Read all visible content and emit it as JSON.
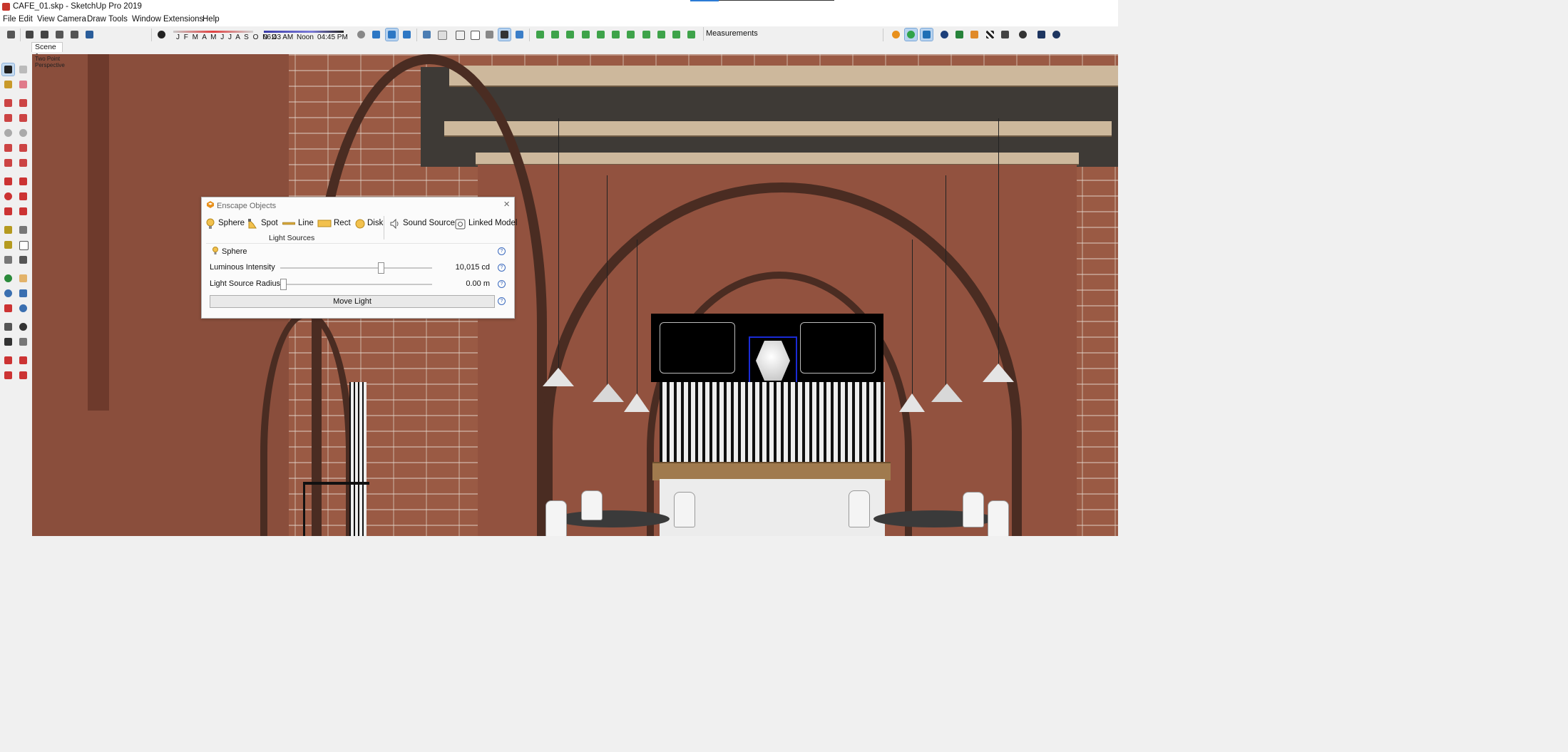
{
  "window": {
    "title": "CAFE_01.skp - SketchUp Pro 2019"
  },
  "menu": [
    "File",
    "Edit",
    "View",
    "Camera",
    "Draw",
    "Tools",
    "Window",
    "Extensions",
    "Help"
  ],
  "shadow": {
    "months": "J F M A M J J A S O N D",
    "time_start": "06:43 AM",
    "time_mid": "Noon",
    "time_end": "04:45 PM"
  },
  "measurements": {
    "label": "Measurements"
  },
  "scene": {
    "tab": "Scene 1"
  },
  "viewport": {
    "label": "Two Point\nPerspective"
  },
  "enscape": {
    "title": "Enscape Objects",
    "objects": [
      {
        "label": "Sphere",
        "icon": "bulb-icon"
      },
      {
        "label": "Spot",
        "icon": "spotlight-icon"
      },
      {
        "label": "Line",
        "icon": "line-light-icon"
      },
      {
        "label": "Rect",
        "icon": "rect-light-icon"
      },
      {
        "label": "Disk",
        "icon": "disk-light-icon"
      },
      {
        "label": "Sound Source",
        "icon": "speaker-icon"
      },
      {
        "label": "Linked Model",
        "icon": "linked-model-icon"
      }
    ],
    "group_label": "Light Sources",
    "panel": {
      "title": "Sphere",
      "luminous_label": "Luminous Intensity",
      "luminous_value": "10,015 cd",
      "luminous_level": 0.67,
      "radius_label": "Light Source Radius",
      "radius_value": "0.00 m",
      "radius_level": 0.0,
      "move_button": "Move Light"
    }
  },
  "colors": {
    "selection_accent": "#b8d3ef",
    "brick": "#9a5a44",
    "arch": "#4a2c22"
  }
}
